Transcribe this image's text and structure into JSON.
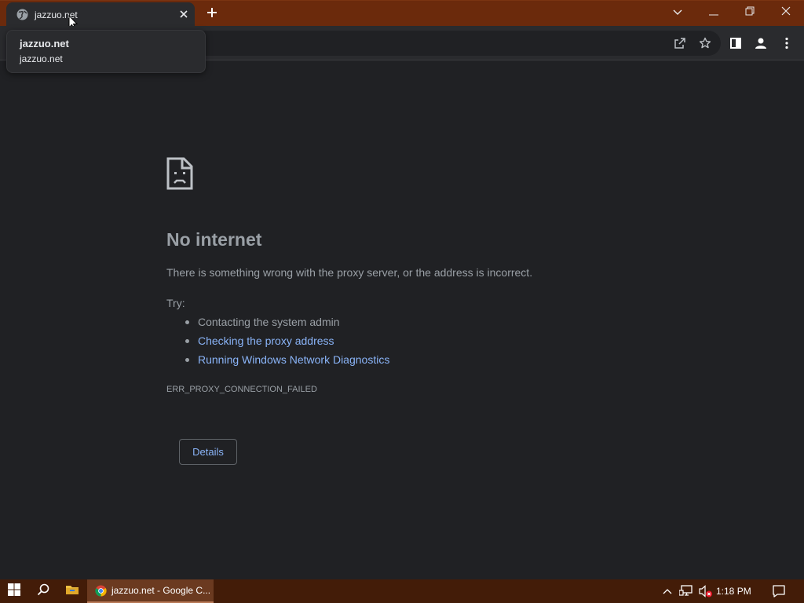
{
  "tab": {
    "title": "jazzuo.net",
    "favicon": "globe-icon",
    "close_icon": "close-icon",
    "new_tab_icon": "plus-icon"
  },
  "hover_card": {
    "title": "jazzuo.net",
    "domain": "jazzuo.net"
  },
  "window_controls": [
    "tab-search-icon",
    "minimize-icon",
    "restore-icon",
    "close-icon"
  ],
  "toolbar": {
    "icons": [
      "share-icon",
      "star-icon",
      "side-panel-icon",
      "profile-icon",
      "menu-icon"
    ]
  },
  "error": {
    "icon": "sad-page-icon",
    "heading": "No internet",
    "description": "There is something wrong with the proxy server, or the address is incorrect.",
    "try_label": "Try:",
    "suggestions": [
      {
        "text": "Contacting the system admin",
        "link": false
      },
      {
        "text": "Checking the proxy address",
        "link": true
      },
      {
        "text": "Running Windows Network Diagnostics",
        "link": true
      }
    ],
    "code": "ERR_PROXY_CONNECTION_FAILED",
    "details_button": "Details"
  },
  "taskbar": {
    "start_icon": "windows-logo-icon",
    "search_icon": "search-icon",
    "explorer_icon": "folder-icon",
    "app_label": "jazzuo.net - Google C...",
    "tray_icons": [
      "chevron-up-icon",
      "network-icon",
      "speaker-muted-icon"
    ],
    "clock": "1:18 PM",
    "notification_icon": "notification-icon"
  },
  "colors": {
    "title_bar": "#6b2a0c",
    "taskbar": "#431c08",
    "page_bg": "#202124",
    "text_secondary": "#9aa0a6",
    "link": "#8ab4f8"
  }
}
